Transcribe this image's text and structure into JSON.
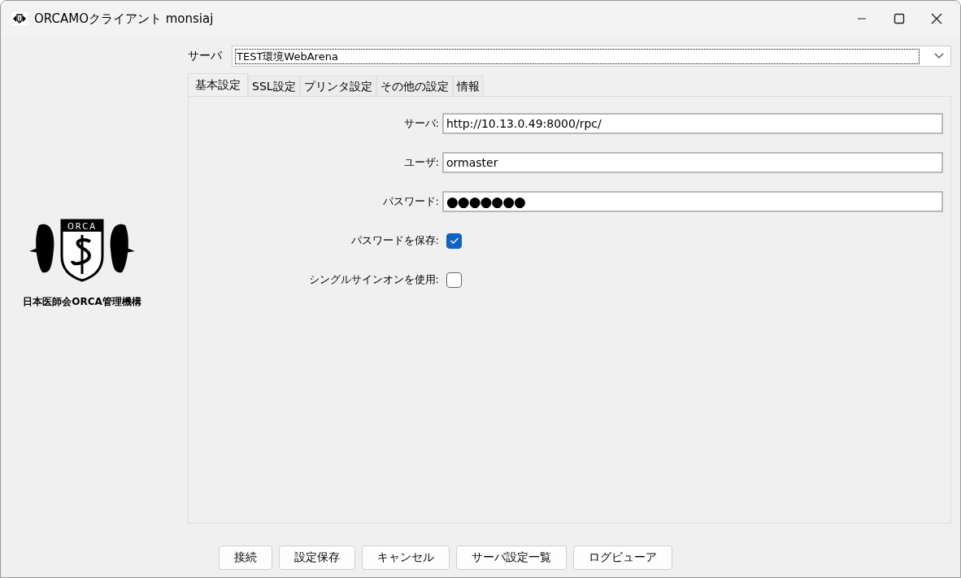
{
  "window": {
    "title": "ORCAMOクライアント monsiaj"
  },
  "logo": {
    "caption": "日本医師会ORCA管理機構",
    "badge_text": "ORCA"
  },
  "server_select": {
    "label": "サーバ",
    "value": "TEST環境WebArena"
  },
  "tabs": [
    {
      "label": "基本設定",
      "selected": true
    },
    {
      "label": "SSL設定",
      "selected": false
    },
    {
      "label": "プリンタ設定",
      "selected": false
    },
    {
      "label": "その他の設定",
      "selected": false
    },
    {
      "label": "情報",
      "selected": false
    }
  ],
  "form": [
    {
      "kind": "text",
      "label": "サーバ:",
      "value": "http://10.13.0.49:8000/rpc/"
    },
    {
      "kind": "text",
      "label": "ユーザ:",
      "value": "ormaster"
    },
    {
      "kind": "password",
      "label": "パスワード:",
      "value": "●●●●●●●"
    },
    {
      "kind": "checkbox",
      "label": "パスワードを保存:",
      "checked": true
    },
    {
      "kind": "checkbox",
      "label": "シングルサインオンを使用:",
      "checked": false
    }
  ],
  "buttons": [
    "接続",
    "設定保存",
    "キャンセル",
    "サーバ設定一覧",
    "ログビューア"
  ]
}
